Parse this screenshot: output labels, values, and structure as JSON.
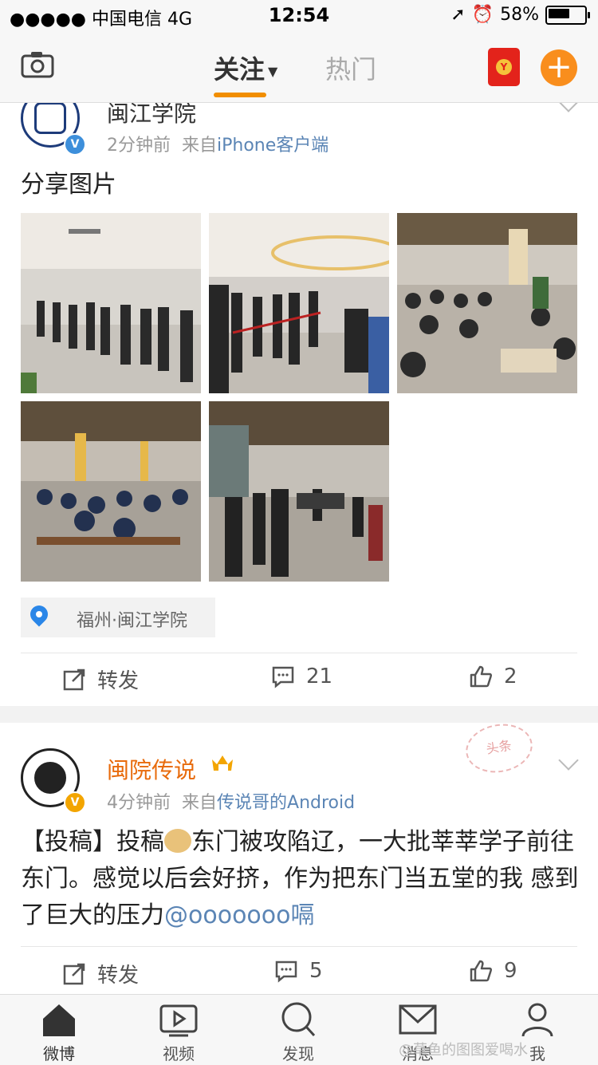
{
  "status_bar": {
    "carrier": "●●●●● 中国电信  4G",
    "time": "12:54",
    "battery": "58%"
  },
  "nav": {
    "tab_follow": "关注",
    "tab_hot": "热门",
    "redpacket_icon": "red-envelope-icon",
    "camera_icon": "camera-icon",
    "plus_icon": "plus-icon"
  },
  "post1": {
    "username": "闽江学院",
    "time": "2分钟前",
    "from_prefix": "来自",
    "source": "iPhone客户端",
    "text": "分享图片",
    "photos": [
      {
        "label": "photo-1"
      },
      {
        "label": "photo-2"
      },
      {
        "label": "photo-3"
      },
      {
        "label": "photo-4"
      },
      {
        "label": "photo-5"
      }
    ],
    "location": "福州·闽江学院",
    "actions": {
      "repost": "转发",
      "comments": "21",
      "likes": "2"
    }
  },
  "post2": {
    "username": "闽院传说",
    "time": "4分钟前",
    "from_prefix": "来自",
    "source": "传说哥的Android",
    "stamp": "头条",
    "text_part1": "【投稿】投稿",
    "text_part2": "东门被攻陷辽，一大批莘莘学子前往东门。感觉以后会好挤，作为把东门当五堂的我 感到了巨大的压力",
    "mention": "@ooooooo嗝",
    "actions": {
      "repost": "转发",
      "comments": "5",
      "likes": "9"
    }
  },
  "tabbar": {
    "items": [
      {
        "label": "微博",
        "icon": "home-icon"
      },
      {
        "label": "视频",
        "icon": "video-icon"
      },
      {
        "label": "发现",
        "icon": "search-icon"
      },
      {
        "label": "消息",
        "icon": "mail-icon"
      },
      {
        "label": "我",
        "icon": "profile-icon"
      }
    ]
  },
  "watermark": "@草鱼的图图爱喝水",
  "colors": {
    "accent": "#f18e00",
    "link": "#5b85b5",
    "verified_blue": "#3d8fdb",
    "verified_gold": "#f3a500"
  }
}
